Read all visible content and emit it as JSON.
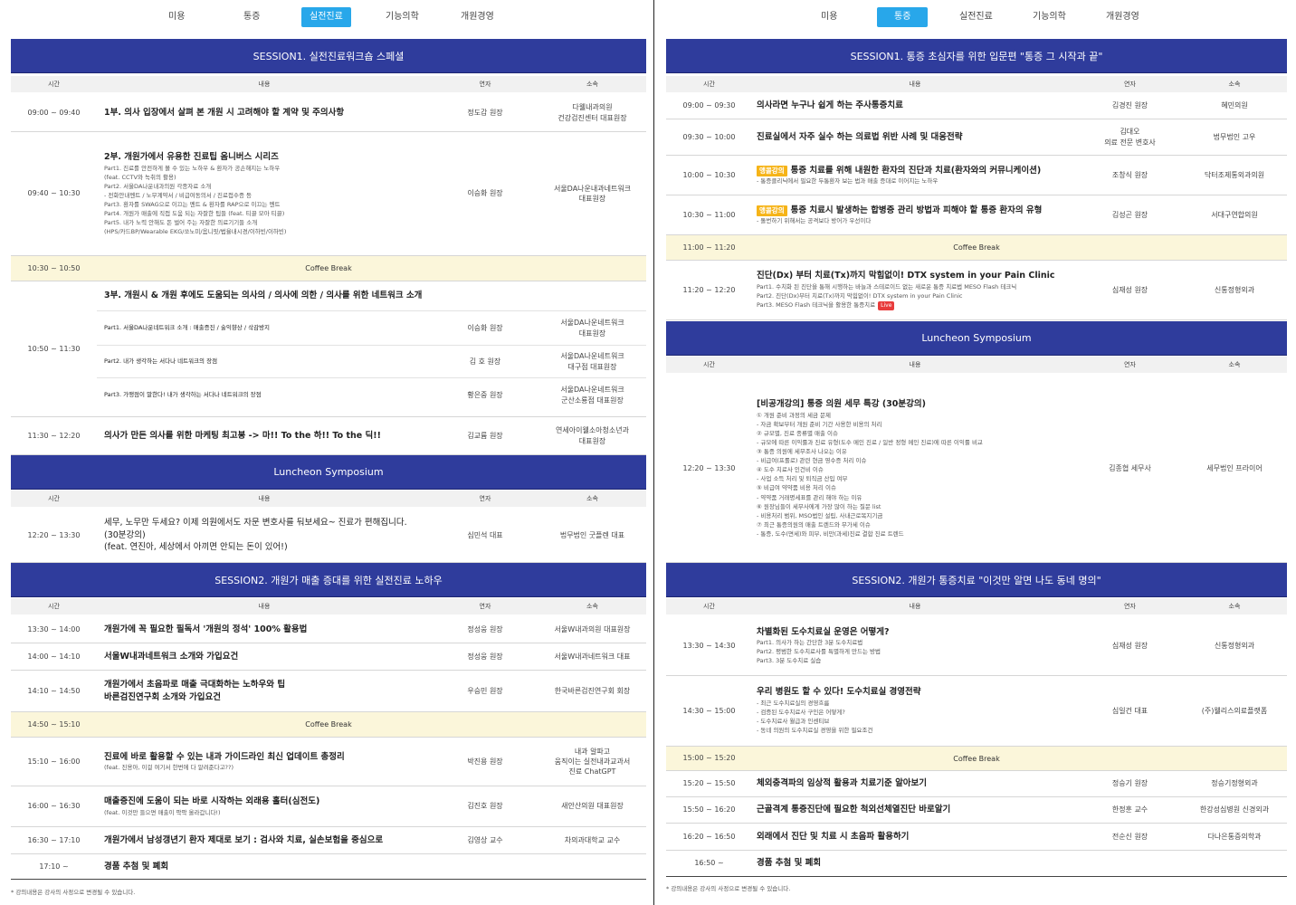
{
  "left": {
    "tabs": [
      "미용",
      "통증",
      "실전진료",
      "기능의학",
      "개원경영"
    ],
    "active_tab": 2,
    "col_headers": {
      "time": "시간",
      "content": "내용",
      "speaker": "연자",
      "affiliation": "소속"
    },
    "session1_title": "SESSION1. 실전진료워크숍 스페셜",
    "s1_rows": {
      "r1": {
        "time": "09:00 ~ 09:40",
        "title": "1부. 의사 입장에서 살펴 본 개원 시 고려해야 할 계약 및 주의사항",
        "speaker": "정도감 원장",
        "aff": "다웰내과의원\n건강검진센터 대표원장"
      },
      "r2": {
        "time": "09:40 ~ 10:30",
        "title": "2부. 개원가에서 유용한 진료팁 옴니버스 시리즈",
        "subs": [
          "Part1. 진료를 안전하게 볼 수 있는 노하우 & 환자가 공손해지는 노하우",
          "(feat. CCTV와 녹취의 활용)",
          "Part2. 서울DA나운내과의원 각종자료 소개",
          "- 전화안내멘트 / 노무계약서 / 비급여동의서 / 진료접수증 등",
          "Part3. 환자를 SWAG으로 이끄는 멘트 & 환자를 RAP으로 이끄는 멘트",
          "Part4. 개원가 매출에 직접 도움 되는 자잘한 팁들 (feat. 티끌 모아 티끌)",
          "Part5. 내가 노력 안해도 돈 벌어 주는 자잘한 의료기기들 소개",
          "(HPS/카드BP/Wearable EKG/쏘노미/옴니핏/법율내시경/이하빈/이하빈)"
        ],
        "speaker": "이승화 원장",
        "aff": "서울DA나운내과네트워크\n대표원장"
      },
      "cb1": {
        "time": "10:30 ~ 10:50",
        "label": "Coffee Break"
      },
      "r3": {
        "time": "10:50 ~ 11:30",
        "title": "3부. 개원시 & 개원 후에도 도움되는 의사의 / 의사에 의한 / 의사를 위한 네트워크 소개",
        "parts": [
          {
            "text": "Part1. 서울DA나운네트워크 소개 : 매출증진 / 술익향상 / 삭감방지",
            "speaker": "이승화 원장",
            "aff": "서울DA나운네트워크\n대표원장"
          },
          {
            "text": "Part2. 내가 생각하는 서다나 네트워크의 장점",
            "speaker": "김 호 원장",
            "aff": "서울DA나운네트워크\n대구점 대표원장"
          },
          {
            "text": "Part3. 가맹점이 말한다! 내가 생각하는 서다나 네트워크의 장점",
            "speaker": "황은중 원장",
            "aff": "서울DA나운네트워크\n군산소룡점 대표원장"
          }
        ]
      },
      "r4": {
        "time": "11:30 ~ 12:20",
        "title": "의사가 만든 의사를 위한 마케팅 최고봉 -> 마!! To the 하!! To the 딕!!",
        "speaker": "김교륨 원장",
        "aff": "연세아이웰소아청소년과\n대표원장"
      }
    },
    "luncheon_title": "Luncheon Symposium",
    "lunch_row": {
      "time": "12:20 ~ 13:30",
      "lines": [
        "세무, 노무만 두세요? 이제 의원에서도 자문 변호사를 둬보세요~ 진료가 편해집니다.",
        "(30분강의)",
        "(feat. 연진아, 세상에서 아끼면 안되는 돈이 있어!)"
      ],
      "speaker": "심민석 대표",
      "aff": "법무법인 굿플렌 대표"
    },
    "session2_title": "SESSION2. 개원가 매출 증대를 위한 실전진료 노하우",
    "s2_rows": [
      {
        "time": "13:30 ~ 14:00",
        "title": "개원가에 꼭 필요한 필독서 '개원의 정석' 100% 활용법",
        "speaker": "정성웅 원장",
        "aff": "서울W내과의원 대표원장"
      },
      {
        "time": "14:00 ~ 14:10",
        "title": "서울W내과네트워크 소개와 가입요건",
        "speaker": "정성웅 원장",
        "aff": "서울W내과네트워크 대표"
      },
      {
        "time": "14:10 ~ 14:50",
        "title": "개원가에서 초음파로 매출 극대화하는 노하우와 팁\n바른검진연구회 소개와 가입요건",
        "speaker": "우승민 원장",
        "aff": "한국바른검진연구회 회장"
      },
      {
        "time": "14:50 ~ 15:10",
        "cb": "Coffee Break"
      },
      {
        "time": "15:10 ~ 16:00",
        "title": "진료에 바로 활용할 수 있는 내과 가이드라인 최신 업데이트 총정리",
        "sub": "(feat. 진용아, 이걸 여기서 한번에 다 알려준다고??)",
        "speaker": "박진용 원장",
        "aff": "내과 알파고\n움직이는 실전내과교과서\n진료 ChatGPT"
      },
      {
        "time": "16:00 ~ 16:30",
        "title": "매출증진에 도움이 되는 바로 시작하는 외래용 홀터(심전도)",
        "sub": "(feat. 이것만 들으면 매출이 팍팍 올라갑니다!)",
        "speaker": "김진호 원장",
        "aff": "새안산의원 대표원장"
      },
      {
        "time": "16:30 ~ 17:10",
        "title": "개원가에서 남성갱년기 환자 제대로 보기 : 검사와 치료, 실손보험을 중심으로",
        "speaker": "김영상 교수",
        "aff": "차의과대학교 교수"
      },
      {
        "time": "17:10 ~",
        "title": "경품 추첨 및 폐회"
      }
    ],
    "footnote": "* 강의내용은 강사의 사정으로 변경될 수 있습니다."
  },
  "right": {
    "tabs": [
      "미용",
      "통증",
      "실전진료",
      "기능의학",
      "개원경영"
    ],
    "active_tab": 1,
    "col_headers": {
      "time": "시간",
      "content": "내용",
      "speaker": "연자",
      "affiliation": "소속"
    },
    "session1_title": "SESSION1. 통증 초심자를 위한 입문편 \"통증 그 시작과 끝\"",
    "s1_rows": [
      {
        "time": "09:00 ~ 09:30",
        "title": "의사라면 누구나 쉽게 하는 주사통증치료",
        "speaker": "김경진 원장",
        "aff": "혜민의원"
      },
      {
        "time": "09:30 ~ 10:00",
        "title": "진료실에서 자주 실수 하는 의료법 위반 사례 및 대응전략",
        "speaker": "김대오\n의료 전문 변호사",
        "aff": "법무법인 고우"
      },
      {
        "time": "10:00 ~ 10:30",
        "badge": "앵콜강의",
        "title": "통증 치료를 위해 내원한 환자의 진단과 치료(환자와의 커뮤니케이션)",
        "sub": "- 통증클리닉에서 필요한 두통환자 보는 법과 매출 증대로 이어지는 노하우",
        "speaker": "조창식 원장",
        "aff": "닥터조제통외과의원"
      },
      {
        "time": "10:30 ~ 11:00",
        "badge": "앵콜강의",
        "title": "통증 치료시 발생하는 합병증 관리 방법과 피해야 할 통증 환자의 유형",
        "sub": "- 돌번하기 위해서는 공격보다 방어가 우선이다",
        "speaker": "김성곤 원장",
        "aff": "서대구연합의원"
      },
      {
        "time": "11:00 ~ 11:20",
        "cb": "Coffee Break"
      },
      {
        "time": "11:20 ~ 12:20",
        "title": "진단(Dx) 부터 치료(Tx)까지 막힘없이! DTX system in your Pain Clinic",
        "subs": [
          "Part1. 수치화 된 진단을 통해 시행하는 바늘과 스테로이드 없는 새로운 통증 치료법 MESO Flash 테크닉",
          "Part2. 진단(Dx)부터 치료(Tx)까지 막힘없이! DTX system in your Pain Clinic",
          "Part3. MESO Flash 테크닉을 활용한 통증치료"
        ],
        "live": "Live",
        "speaker": "심재성 원장",
        "aff": "신통정형외과"
      }
    ],
    "luncheon_title": "Luncheon Symposium",
    "lunch_row": {
      "time": "12:20 ~ 13:30",
      "title": "[비공개강의] 통증 의원 세무 특강 (30분강의)",
      "subs": [
        "① 개원 준비 과정의 세금 문제",
        "- 자금 확보부터 개원 준비 기간 사용한 비용의 처리",
        "② 규모별, 진료 종류별 매출 이슈",
        "- 규모에 따른 이익률과 진료 유형(도수 메인 진료 / 일반 정형 메인 진료)에 따른 이익률 비교",
        "③ 통증 의원에 세무조사 나오는 이유",
        "- 비급여(프롤로) 관련 현금 영수증 처리 이슈",
        "④ 도수 치료사 인건비 이슈",
        "- 사업 소득 처리 및 퇴직금 산입 여부",
        "⑤ 비급여 약약품 비용 처리 이슈",
        "- 약약품 거래명세표를 관리 해야 하는 이유",
        "⑥ 원장님들이 세무사에게 가장 많이 하는 질문 list",
        "- 비용처리 범위, MSO법인 설립, 사내근로복지기금",
        "⑦ 최근 통증의원의 매출 트렌드와 무가세 이슈",
        "- 통증, 도수(면세)와 피부, 비만(과세)진료 결합 진료 트렌드"
      ],
      "speaker": "김종협 세무사",
      "aff": "세무법인 프라이어"
    },
    "session2_title": "SESSION2. 개원가 통증치료 \"이것만 알면 나도 동네 명의\"",
    "s2_rows": [
      {
        "time": "13:30 ~ 14:30",
        "title": "차별화된 도수치료실 운영은 어떻게?",
        "subs": [
          "Part1. 의사가 하는 간단한 3분 도수치료법",
          "Part2. 평범한 도수치료사를 특별하게 만드는 방법",
          "Part3. 3분 도수치료 실습"
        ],
        "speaker": "심재성 원장",
        "aff": "신통정형외과"
      },
      {
        "time": "14:30 ~ 15:00",
        "title": "우리 병원도 할 수 있다! 도수치료실 경영전략",
        "subs": [
          "- 최근 도수치료실의 경영흐름",
          "- 검증된 도수치료사 구인은 어떻게?",
          "- 도수치료사 월급과 인센티브",
          "- 동네 의원의 도수치료실 경영을 위한 필요조건"
        ],
        "speaker": "심일건 대표",
        "aff": "(주)웰리스의료플랫폼"
      },
      {
        "time": "15:00 ~ 15:20",
        "cb": "Coffee Break"
      },
      {
        "time": "15:20 ~ 15:50",
        "title": "체외충격파의 임상적 활용과 치료기준 알아보기",
        "speaker": "정승기 원장",
        "aff": "정승기정형외과"
      },
      {
        "time": "15:50 ~ 16:20",
        "title": "근골격계 통증진단에 필요한 척외선체열진단 바로알기",
        "speaker": "한정훈 교수",
        "aff": "한강성심병원 신경외과"
      },
      {
        "time": "16:20 ~ 16:50",
        "title": "외래에서 진단 및 치료 시 초음파 활용하기",
        "speaker": "전순신 원장",
        "aff": "다나은통증의학과"
      },
      {
        "time": "16:50 ~",
        "title": "경품 추첨 및 폐회"
      }
    ],
    "footnote": "* 강의내용은 강사의 사정으로 변경될 수 있습니다."
  }
}
